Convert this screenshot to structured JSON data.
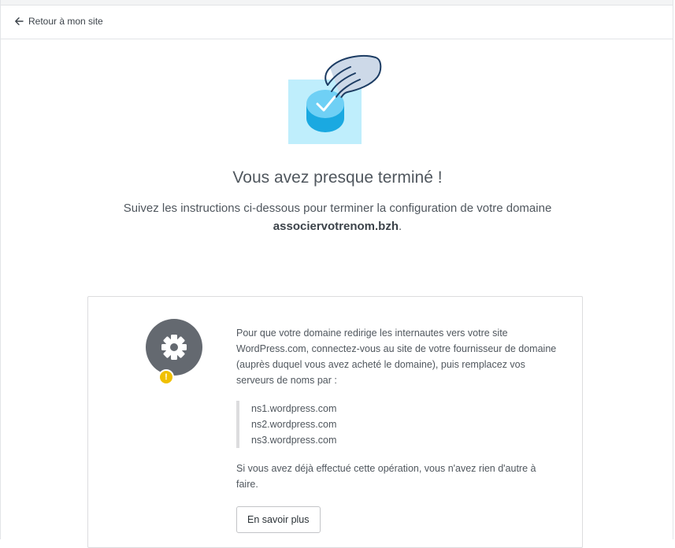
{
  "topbar": {
    "back_label": "Retour à mon site",
    "back_icon": "arrow-left-icon"
  },
  "hero": {
    "illustration": "hand-checkmark-illustration"
  },
  "main": {
    "title": "Vous avez presque terminé !",
    "subtitle_line1": "Suivez les instructions ci-dessous pour terminer la configuration de votre domaine",
    "domain": "associervotrenom.bzh",
    "domain_suffix": "."
  },
  "card": {
    "icon": "gear-icon",
    "badge_icon": "warning-icon",
    "badge_text": "!",
    "intro": "Pour que votre domaine redirige les internautes vers votre site WordPress.com, connectez-vous au site de votre fournisseur de domaine (auprès duquel vous avez acheté le domaine), puis remplacez vos serveurs de noms par :",
    "nameservers": [
      "ns1.wordpress.com",
      "ns2.wordpress.com",
      "ns3.wordpress.com"
    ],
    "note": "Si vous avez déjà effectué cette opération, vous n'avez rien d'autre à faire.",
    "button_label": "En savoir plus"
  },
  "colors": {
    "text": "#3c434a",
    "muted": "#50575e",
    "gear_bg": "#646970",
    "badge": "#f0c000",
    "hero_light_blue": "#bfeefc",
    "hero_blue": "#1aa9e1"
  }
}
